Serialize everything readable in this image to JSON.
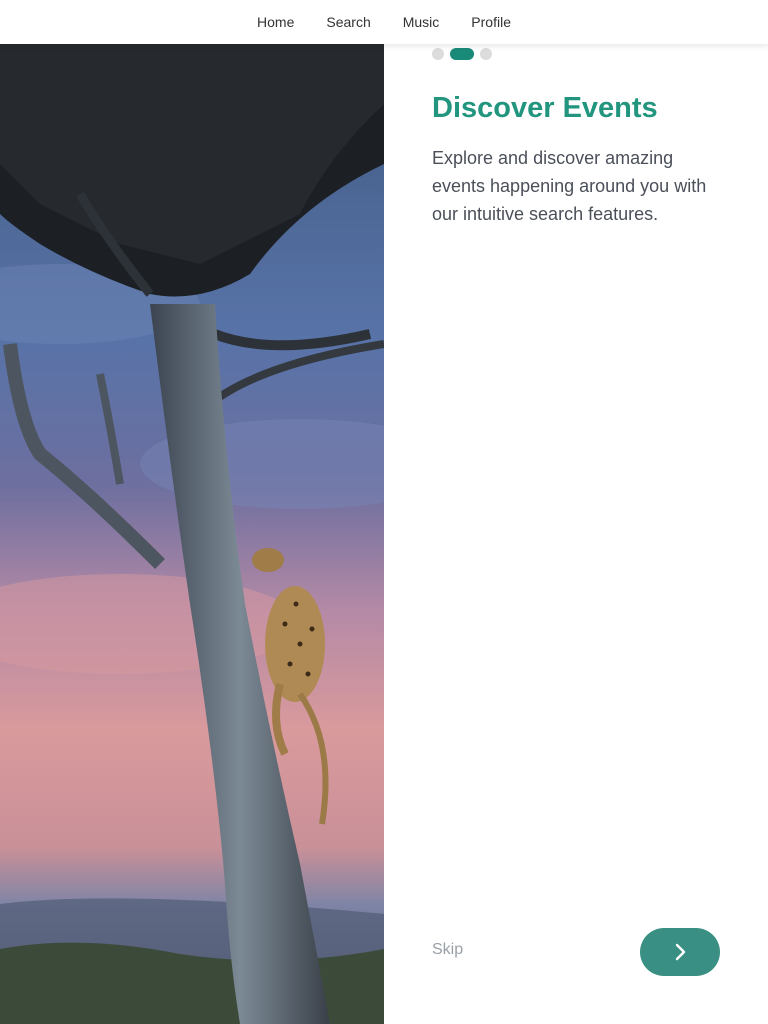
{
  "nav": {
    "items": [
      {
        "label": "Home"
      },
      {
        "label": "Search"
      },
      {
        "label": "Music"
      },
      {
        "label": "Profile"
      }
    ]
  },
  "hero": {
    "image": "leopard-climbing-tree-at-dusk"
  },
  "onboarding": {
    "current_step": 2,
    "total_steps": 3,
    "title": "Discover Events",
    "description": "Explore and discover amazing events happening around you with our intuitive search features.",
    "skip_label": "Skip",
    "next_icon": "chevron-right-icon"
  },
  "colors": {
    "accent": "#22957f",
    "button": "#3a8f85",
    "dot_inactive": "#dcdcdc",
    "text": "#4a4f59",
    "muted": "#9aa0a8"
  }
}
